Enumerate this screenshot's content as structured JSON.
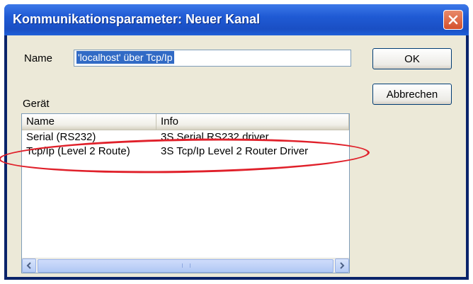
{
  "window": {
    "title": "Kommunikationsparameter: Neuer Kanal"
  },
  "name_field": {
    "label": "Name",
    "value": "'localhost' über Tcp/Ip"
  },
  "buttons": {
    "ok": "OK",
    "cancel": "Abbrechen"
  },
  "device": {
    "label": "Gerät",
    "columns": [
      "Name",
      "Info"
    ],
    "rows": [
      {
        "name": "Serial (RS232)",
        "info": "3S Serial RS232 driver"
      },
      {
        "name": "Tcp/Ip (Level 2 Route)",
        "info": "3S Tcp/Ip Level 2 Router Driver"
      }
    ]
  },
  "colors": {
    "title_bar": "#1f5ad4",
    "close": "#d4502c",
    "annotation": "#e0202a",
    "selection": "#316ac5"
  },
  "icons": [
    "close-icon",
    "scroll-left-icon",
    "scroll-right-icon"
  ]
}
